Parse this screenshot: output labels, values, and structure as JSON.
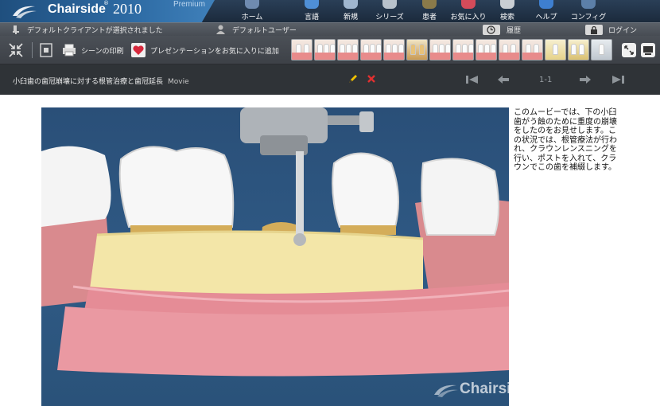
{
  "app": {
    "name": "Chairside",
    "year": "2010",
    "edition": "Premium"
  },
  "menu": [
    {
      "label": "ホーム",
      "icon": "home-icon"
    },
    {
      "label": "言語",
      "icon": "language-icon"
    },
    {
      "label": "新規",
      "icon": "new-icon"
    },
    {
      "label": "シリーズ",
      "icon": "series-icon"
    },
    {
      "label": "患者",
      "icon": "patient-icon"
    },
    {
      "label": "お気に入り",
      "icon": "favorites-icon"
    },
    {
      "label": "検索",
      "icon": "search-icon"
    },
    {
      "label": "ヘルプ",
      "icon": "help-icon"
    },
    {
      "label": "コンフィグ",
      "icon": "config-icon"
    }
  ],
  "status": {
    "client": "デフォルトクライアントが選択されました",
    "user": "デフォルトユーザー",
    "history": "履歴",
    "login": "ログイン"
  },
  "toolbar": {
    "print_scene": "シーンの印刷",
    "add_favorite": "プレゼンテーションをお気に入りに追加"
  },
  "title": {
    "text": "小臼歯の歯冠崩壊に対する根管治療と歯冠延長",
    "type": "Movie",
    "page_count": "1-1"
  },
  "video": {
    "watermark": "Chairside"
  },
  "description": "このムービーでは、下の小臼歯がう蝕のために重度の崩壊をしたのをお見せします。この状況では、根管療法が行われ、クラウンレンスニングを行い、ポストを入れて、クラウンでこの歯を補綴します。",
  "colors": {
    "accent": "#2d6aa3",
    "gum": "#e88b8b",
    "background_dark": "#2f3337",
    "video_bg": "#2f5a85"
  }
}
